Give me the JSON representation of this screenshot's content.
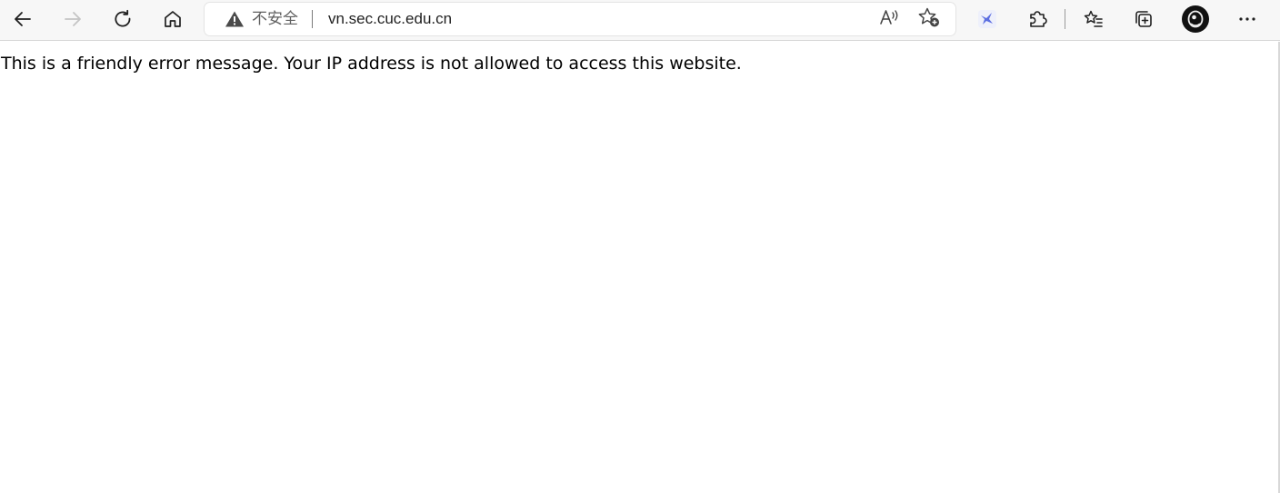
{
  "toolbar": {
    "back_icon": "arrow-left-icon",
    "forward_icon": "arrow-right-icon",
    "refresh_icon": "refresh-icon",
    "home_icon": "home-icon",
    "read_aloud_icon": "read-aloud-icon",
    "add_favorite_icon": "star-plus-icon",
    "extension_icon": "bird-extension-icon",
    "extensions_icon": "puzzle-icon",
    "favorites_icon": "favorites-list-icon",
    "collections_icon": "collections-icon",
    "profile_icon": "avatar",
    "menu_icon": "more-icon"
  },
  "address_bar": {
    "security_label": "不安全",
    "security_icon": "warning-icon",
    "url": "vn.sec.cuc.edu.cn"
  },
  "page": {
    "message": "This is a friendly error message. Your IP address is not allowed to access this website."
  },
  "colors": {
    "toolbar_bg": "#f7f7f7",
    "icon": "#1f1f1f",
    "disabled_icon": "#c4c4c4",
    "extension_accent": "#5b6ee1"
  }
}
